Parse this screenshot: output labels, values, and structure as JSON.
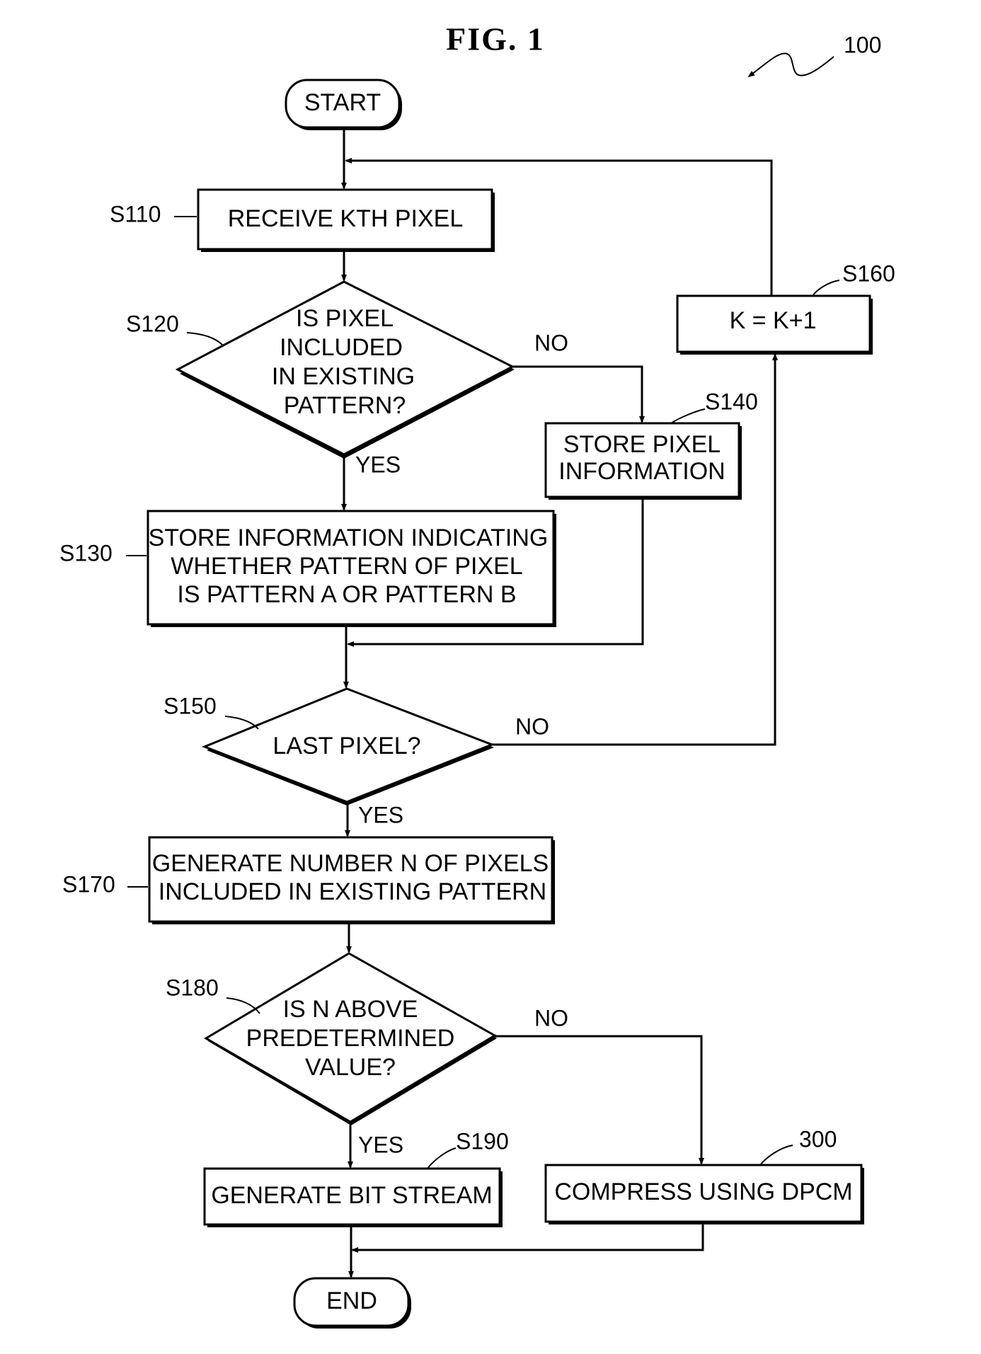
{
  "figure": {
    "title": "FIG. 1",
    "reference_number": "100"
  },
  "nodes": {
    "start": {
      "text": "START"
    },
    "s110": {
      "step": "S110",
      "lines": [
        "RECEIVE KTH PIXEL"
      ]
    },
    "s120": {
      "step": "S120",
      "lines": [
        "IS PIXEL",
        "INCLUDED",
        "IN EXISTING",
        "PATTERN?"
      ]
    },
    "s130": {
      "step": "S130",
      "lines": [
        "STORE INFORMATION INDICATING",
        "WHETHER PATTERN OF PIXEL",
        "IS PATTERN A OR PATTERN B"
      ]
    },
    "s140": {
      "step": "S140",
      "lines": [
        "STORE PIXEL",
        "INFORMATION"
      ]
    },
    "s150": {
      "step": "S150",
      "lines": [
        "LAST PIXEL?"
      ]
    },
    "s160": {
      "step": "S160",
      "lines": [
        "K = K+1"
      ]
    },
    "s170": {
      "step": "S170",
      "lines": [
        "GENERATE NUMBER N OF PIXELS",
        "INCLUDED IN EXISTING PATTERN"
      ]
    },
    "s180": {
      "step": "S180",
      "lines": [
        "IS N ABOVE",
        "PREDETERMINED",
        "VALUE?"
      ]
    },
    "s190": {
      "step": "S190",
      "lines": [
        "GENERATE BIT STREAM"
      ]
    },
    "n300": {
      "step": "300",
      "lines": [
        "COMPRESS USING DPCM"
      ]
    },
    "end": {
      "text": "END"
    }
  },
  "branches": {
    "s120_no": "NO",
    "s120_yes": "YES",
    "s150_no": "NO",
    "s150_yes": "YES",
    "s180_no": "NO",
    "s180_yes": "YES"
  }
}
